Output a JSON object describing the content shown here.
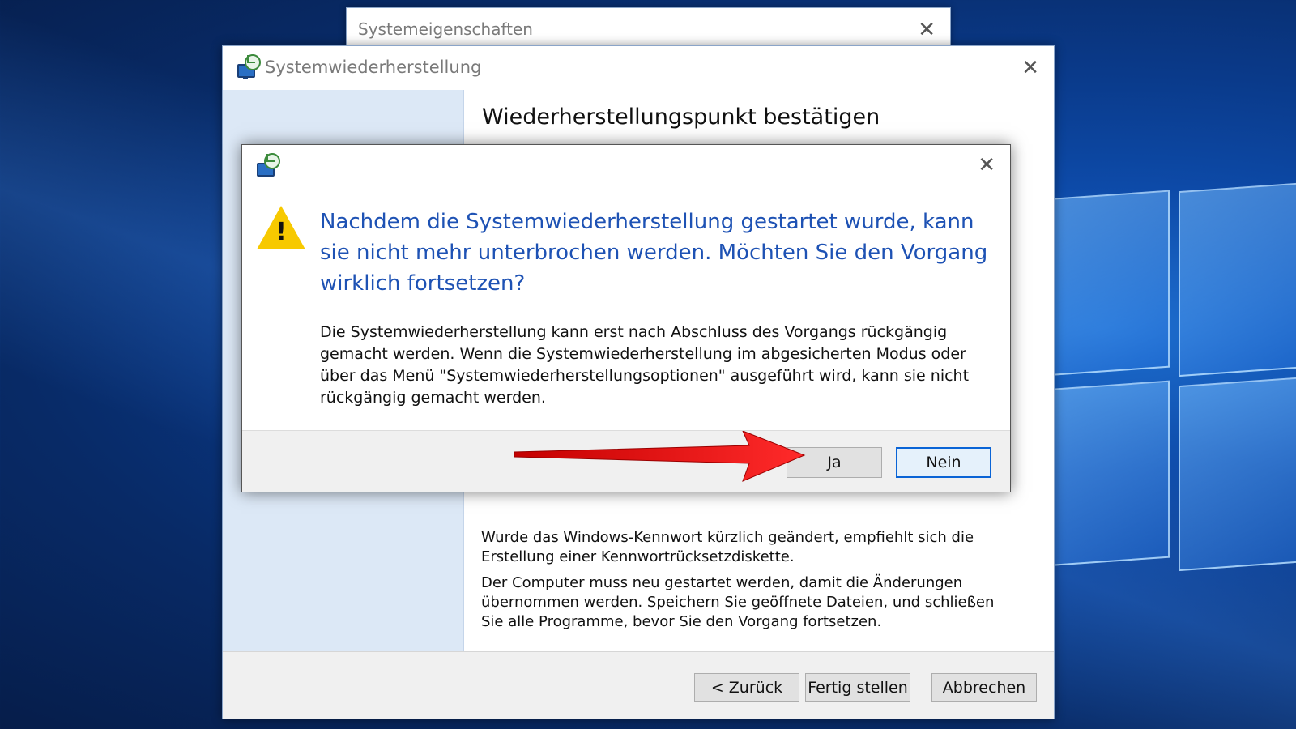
{
  "back_window": {
    "title": "Systemeigenschaften"
  },
  "main_window": {
    "title": "Systemwiederherstellung",
    "heading": "Wiederherstellungspunkt bestätigen",
    "paragraph1": "Wurde das Windows-Kennwort kürzlich geändert, empfiehlt sich die Erstellung einer Kennwortrücksetzdiskette.",
    "paragraph2": "Der Computer muss neu gestartet werden, damit die Änderungen übernommen werden. Speichern Sie geöffnete Dateien, und schließen Sie alle Programme, bevor Sie den Vorgang fortsetzen.",
    "buttons": {
      "back": "< Zurück",
      "finish": "Fertig stellen",
      "cancel": "Abbrechen"
    }
  },
  "dialog": {
    "headline": "Nachdem die Systemwiederherstellung gestartet wurde, kann sie nicht mehr unterbrochen werden. Möchten Sie den Vorgang wirklich fortsetzen?",
    "detail": "Die Systemwiederherstellung kann erst nach Abschluss des Vorgangs rückgängig gemacht werden. Wenn die Systemwiederherstellung im abgesicherten Modus oder über das Menü \"Systemwiederherstellungsoptionen\" ausgeführt wird, kann sie nicht rückgängig gemacht werden.",
    "buttons": {
      "yes": "Ja",
      "no": "Nein"
    },
    "warning_icon": "warning-triangle-icon"
  },
  "icons": {
    "close": "✕",
    "app": "system-restore-icon"
  },
  "colors": {
    "accent": "#1e52b4",
    "warning": "#f7c900",
    "annotation_arrow": "#e01818"
  }
}
